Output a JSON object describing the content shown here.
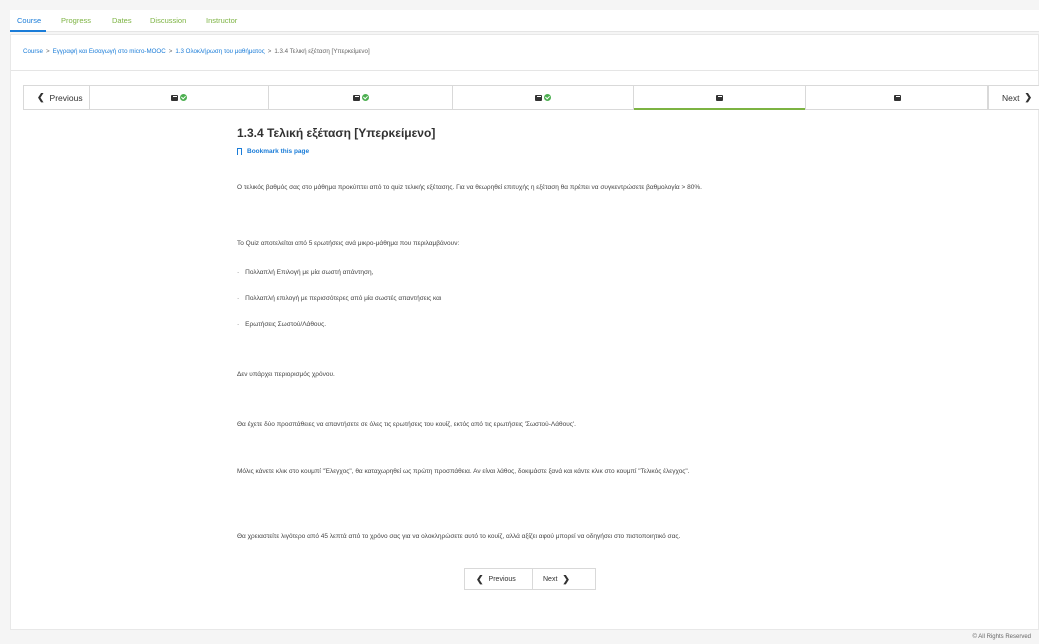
{
  "tabs": [
    {
      "label": "Course",
      "active": true
    },
    {
      "label": "Progress",
      "active": false
    },
    {
      "label": "Dates",
      "active": false
    },
    {
      "label": "Discussion",
      "active": false
    },
    {
      "label": "Instructor",
      "active": false
    }
  ],
  "breadcrumb": {
    "items": [
      "Course",
      "Εγγραφή και Εισαγωγή στο micro-MOOC",
      "1.3 Ολοκλήρωση του μαθήματος",
      "1.3.4 Τελική εξέταση [Υπερκείμενο]"
    ],
    "separator": ">"
  },
  "sequence_nav": {
    "previous_label": "Previous",
    "next_label": "Next",
    "units": [
      {
        "icon": "book-icon",
        "completed": true
      },
      {
        "icon": "book-icon",
        "completed": true
      },
      {
        "icon": "book-icon",
        "completed": true
      },
      {
        "icon": "book-icon",
        "completed": false,
        "active": true
      },
      {
        "icon": "book-icon",
        "completed": false
      }
    ]
  },
  "unit": {
    "title": "1.3.4 Τελική εξέταση [Υπερκείμενο]",
    "bookmark_label": "Bookmark this page",
    "paragraphs": [
      "Ο τελικός βαθμός σας στο μάθημα προκύπτει από το quiz τελικής εξέτασης. Για να θεωρηθεί επιτυχής η εξέταση θα πρέπει να συγκεντρώσετε βαθμολογία > 80%.",
      "Το Quiz αποτελείται από 5 ερωτήσεις ανά μικρο-μάθημα που περιλαμβάνουν:"
    ],
    "bullets": [
      "Πολλαπλή Επιλογή με μία σωστή απάντηση,",
      "Πολλαπλή επιλογή με περισσότερες από μία σωστές απαντήσεις και",
      "Ερωτήσεις Σωστού/Λάθους."
    ],
    "paragraphs_after": [
      "Δεν υπάρχει περιορισμός χρόνου.",
      "Θα έχετε δύο προσπάθειες να απαντήσετε σε όλες τις ερωτήσεις του κουίζ, εκτός από τις ερωτήσεις 'Σωστού-Λάθους'.",
      "Μόλις κάνετε κλικ στο κουμπί \"Έλεγχος\", θα καταχωρηθεί ως πρώτη προσπάθεια. Αν είναι λάθος, δοκιμάστε ξανά και κάντε κλικ στο κουμπί \"Τελικός έλεγχος\".",
      "Θα χρειαστείτε λιγότερο από 45 λεπτά από το χρόνο σας για να ολοκληρώσετε αυτό το κουίζ, αλλά αξίζει αφού μπορεί να οδηγήσει στο πιστοποιητικό σας."
    ]
  },
  "bottom_nav": {
    "previous_label": "Previous",
    "next_label": "Next"
  },
  "footer": {
    "text": "© All Rights Reserved"
  },
  "colors": {
    "link": "#1a7cd8",
    "tab_inactive": "#7cb342",
    "active_unit_underline": "#7cb342",
    "check": "#4caf50"
  }
}
